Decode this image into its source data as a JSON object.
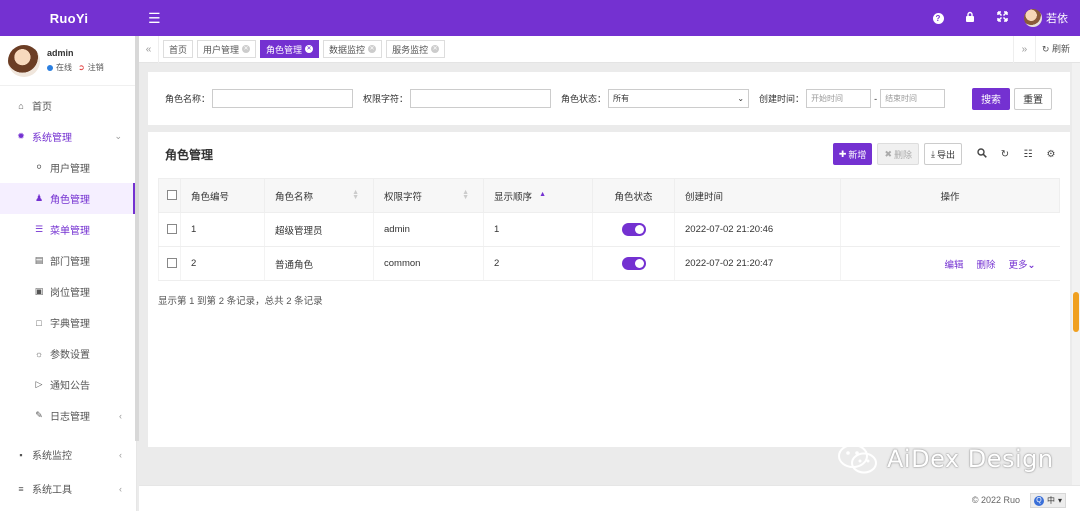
{
  "app": {
    "brand": "RuoYi"
  },
  "topbar": {
    "icons": [
      "question-icon",
      "lock-icon",
      "fullscreen-icon"
    ],
    "user_name": "若依"
  },
  "sidebar": {
    "user": {
      "name": "admin",
      "status": "在线",
      "logout": "注销"
    },
    "items": [
      {
        "label": "首页",
        "icon": "home-icon"
      },
      {
        "label": "系统管理",
        "icon": "gear-icon"
      },
      {
        "label": "用户管理",
        "icon": "user-icon"
      },
      {
        "label": "角色管理",
        "icon": "user-role-icon"
      },
      {
        "label": "菜单管理",
        "icon": "list-icon"
      },
      {
        "label": "部门管理",
        "icon": "dept-icon"
      },
      {
        "label": "岗位管理",
        "icon": "idcard-icon"
      },
      {
        "label": "字典管理",
        "icon": "bookmark-icon"
      },
      {
        "label": "参数设置",
        "icon": "cog-icon"
      },
      {
        "label": "通知公告",
        "icon": "bullhorn-icon"
      },
      {
        "label": "日志管理",
        "icon": "edit-icon"
      },
      {
        "label": "系统监控",
        "icon": "video-icon"
      },
      {
        "label": "系统工具",
        "icon": "bars-icon"
      }
    ]
  },
  "tabs": {
    "items": [
      "首页",
      "用户管理",
      "角色管理",
      "数据监控",
      "服务监控"
    ],
    "active": "角色管理",
    "refresh": "刷新"
  },
  "search": {
    "role_name_label": "角色名称：",
    "role_key_label": "权限字符：",
    "status_label": "角色状态：",
    "status_value": "所有",
    "created_label": "创建时间：",
    "start_placeholder": "开始时间",
    "date_sep": "-",
    "end_placeholder": "结束时间",
    "search_btn": "搜索",
    "reset_btn": "重置"
  },
  "table": {
    "title": "角色管理",
    "add": "新增",
    "delete": "删除",
    "export": "导出",
    "columns": [
      "角色编号",
      "角色名称",
      "权限字符",
      "显示顺序",
      "角色状态",
      "创建时间",
      "操作"
    ],
    "rows": [
      {
        "id": "1",
        "name": "超级管理员",
        "key": "admin",
        "sort": "1",
        "created": "2022-07-02 21:20:46"
      },
      {
        "id": "2",
        "name": "普通角色",
        "key": "common",
        "sort": "2",
        "created": "2022-07-02 21:20:47",
        "ops": [
          "编辑",
          "删除",
          "更多"
        ]
      }
    ],
    "summary": "显示第 1 到第 2 条记录，总共 2 条记录"
  },
  "footer": {
    "copyright": "© 2022 Ruo",
    "ime": "中"
  },
  "watermark": "AiDex Design",
  "colors": {
    "accent": "#7431d1"
  }
}
